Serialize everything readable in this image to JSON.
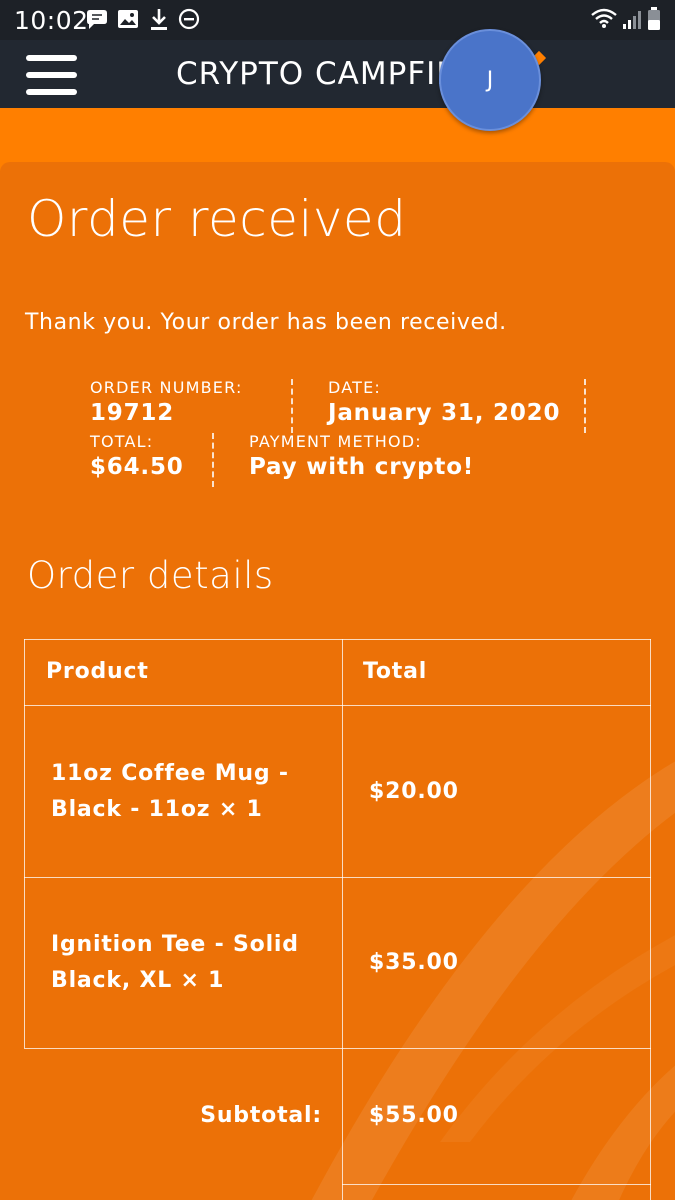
{
  "status_bar": {
    "time": "10:02",
    "left_icons": [
      "chat-bubble-icon",
      "image-icon",
      "download-icon",
      "do-not-disturb-icon"
    ],
    "right_icons": [
      "wifi-icon",
      "signal-icon",
      "battery-icon"
    ]
  },
  "nav": {
    "menu_icon": "hamburger-menu-icon",
    "site_title": "CRYPTO CAMPFIRE",
    "avatar_initial": "J"
  },
  "order": {
    "heading": "Order received",
    "thank_you": "Thank you. Your order has been received.",
    "overview": {
      "order_number_label": "ORDER NUMBER:",
      "order_number": "19712",
      "date_label": "DATE:",
      "date": "January 31, 2020",
      "total_label": "TOTAL:",
      "total": "$64.50",
      "payment_method_label": "PAYMENT METHOD:",
      "payment_method": "Pay with crypto!"
    }
  },
  "details": {
    "heading": "Order details",
    "columns": [
      "Product",
      "Total"
    ],
    "items": [
      {
        "line1": "11oz Coffee Mug -",
        "line2": "Black - 11oz × 1",
        "total": "$20.00"
      },
      {
        "line1": "Ignition Tee - Solid",
        "line2": "Black, XL × 1",
        "total": "$35.00"
      }
    ],
    "subtotal_label": "Subtotal:",
    "subtotal": "$55.00"
  },
  "colors": {
    "page_orange": "#ff7f00",
    "card_orange": "#ec7107",
    "nav_dark": "#222831",
    "status_dark": "#1d2127",
    "avatar_blue": "#4a74c9"
  }
}
